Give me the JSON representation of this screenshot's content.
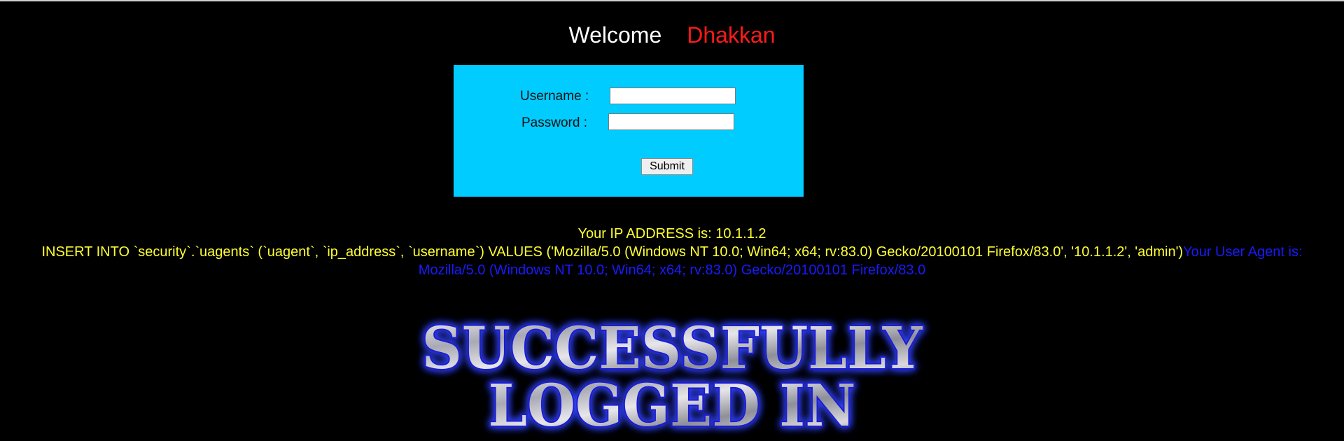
{
  "header": {
    "welcome": "Welcome",
    "name": "Dhakkan"
  },
  "login": {
    "username_label": "Username :",
    "password_label": "Password :",
    "username_value": "",
    "password_value": "",
    "submit_label": "Submit"
  },
  "output": {
    "ip_text": "Your IP ADDRESS is: 10.1.1.2",
    "query_text": "INSERT INTO `security`.`uagents` (`uagent`, `ip_address`, `username`) VALUES ('Mozilla/5.0 (Windows NT 10.0; Win64; x64; rv:83.0) Gecko/20100101 Firefox/83.0', '10.1.1.2', 'admin')",
    "ua_label": "Your User Agent is:",
    "ua_value": "Mozilla/5.0 (Windows NT 10.0; Win64; x64; rv:83.0) Gecko/20100101 Firefox/83.0"
  },
  "banner": {
    "line1": "SUCCESSFULLY",
    "line2": "LOGGED IN"
  },
  "colors": {
    "background": "#000000",
    "login_box": "#00ccff",
    "welcome": "#ffffff",
    "name": "#ff1a1a",
    "info_yellow": "#ffff33",
    "info_blue": "#1a1aff"
  }
}
